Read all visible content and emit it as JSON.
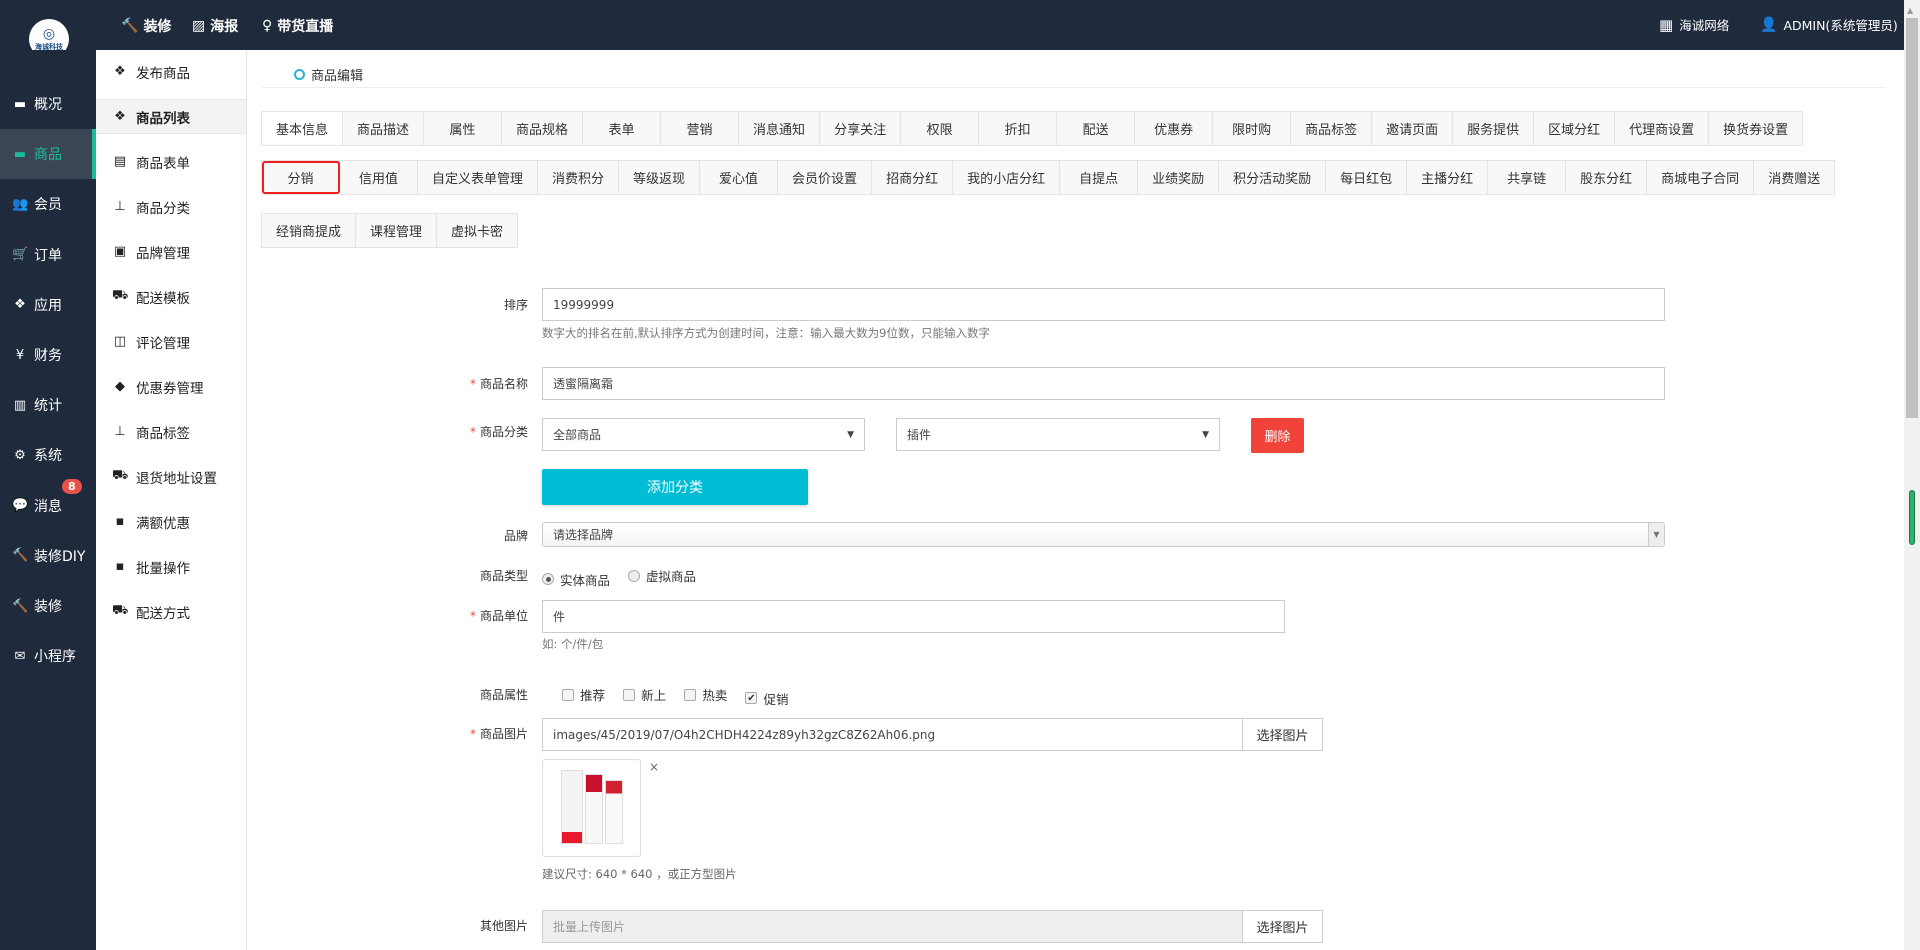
{
  "topbar": {
    "logo_text": "海诚科技",
    "nav": [
      {
        "icon": "hammer-icon",
        "label": "装修"
      },
      {
        "icon": "image-icon",
        "label": "海报"
      },
      {
        "icon": "mic-icon",
        "label": "带货直播"
      }
    ],
    "company": "海诚网络",
    "user": "ADMIN(系统管理员)"
  },
  "sidebar": {
    "items": [
      {
        "label": "概况",
        "icon": "archive-icon"
      },
      {
        "label": "商品",
        "icon": "archive-icon"
      },
      {
        "label": "会员",
        "icon": "users-icon"
      },
      {
        "label": "订单",
        "icon": "cart-icon"
      },
      {
        "label": "应用",
        "icon": "cubes-icon"
      },
      {
        "label": "财务",
        "icon": "yen-icon"
      },
      {
        "label": "统计",
        "icon": "bar-chart-icon"
      },
      {
        "label": "系统",
        "icon": "gears-icon"
      },
      {
        "label": "消息",
        "icon": "chat-icon",
        "badge": "8"
      },
      {
        "label": "装修DIY",
        "icon": "hammer-icon"
      },
      {
        "label": "装修",
        "icon": "hammer-icon"
      },
      {
        "label": "小程序",
        "icon": "wechat-icon"
      }
    ],
    "active": "商品"
  },
  "submenu": {
    "items": [
      {
        "label": "发布商品",
        "icon": "cubes-icon"
      },
      {
        "label": "商品列表",
        "icon": "cubes-icon"
      },
      {
        "label": "商品表单",
        "icon": "excel-icon"
      },
      {
        "label": "商品分类",
        "icon": "sitemap-icon"
      },
      {
        "label": "品牌管理",
        "icon": "briefcase-icon"
      },
      {
        "label": "配送模板",
        "icon": "truck-icon"
      },
      {
        "label": "评论管理",
        "icon": "columns-icon"
      },
      {
        "label": "优惠券管理",
        "icon": "tags-icon"
      },
      {
        "label": "商品标签",
        "icon": "sitemap-icon"
      },
      {
        "label": "退货地址设置",
        "icon": "truck-icon"
      },
      {
        "label": "满额优惠",
        "icon": "gift-icon"
      },
      {
        "label": "批量操作",
        "icon": "gift-icon"
      },
      {
        "label": "配送方式",
        "icon": "truck-icon"
      }
    ],
    "active": "商品列表"
  },
  "breadcrumb": "商品编辑",
  "tabs": {
    "row1": [
      "基本信息",
      "商品描述",
      "属性",
      "商品规格",
      "表单",
      "营销",
      "消息通知",
      "分享关注",
      "权限",
      "折扣",
      "配送",
      "优惠券",
      "限时购",
      "商品标签",
      "邀请页面",
      "服务提供",
      "区域分红",
      "代理商设置",
      "换货券设置"
    ],
    "row2": [
      "分销",
      "信用值",
      "自定义表单管理",
      "消费积分",
      "等级返现",
      "爱心值",
      "会员价设置",
      "招商分红",
      "我的小店分红",
      "自提点",
      "业绩奖励",
      "积分活动奖励",
      "每日红包",
      "主播分红",
      "共享链",
      "股东分红",
      "商城电子合同",
      "消费赠送"
    ],
    "row3": [
      "经销商提成",
      "课程管理",
      "虚拟卡密"
    ],
    "highlighted": "分销"
  },
  "form": {
    "sort": {
      "label": "排序",
      "value": "19999999",
      "hint": "数字大的排名在前,默认排序方式为创建时间，注意：输入最大数为9位数，只能输入数字"
    },
    "name": {
      "label": "商品名称",
      "value": "透蜜隔离霜"
    },
    "category": {
      "label": "商品分类",
      "select1": "全部商品",
      "select2": "插件",
      "delete": "删除",
      "add": "添加分类"
    },
    "brand": {
      "label": "品牌",
      "value": "请选择品牌"
    },
    "type": {
      "label": "商品类型",
      "options": [
        "实体商品",
        "虚拟商品"
      ],
      "selected": "实体商品"
    },
    "unit": {
      "label": "商品单位",
      "value": "件",
      "hint": "如: 个/件/包"
    },
    "attrs": {
      "label": "商品属性",
      "options": [
        {
          "label": "推荐",
          "checked": false
        },
        {
          "label": "新上",
          "checked": false
        },
        {
          "label": "热卖",
          "checked": false
        },
        {
          "label": "促销",
          "checked": true
        }
      ]
    },
    "image": {
      "label": "商品图片",
      "value": "images/45/2019/07/O4h2CHDH4224z89yh32gzC8Z62Ah06.png",
      "button": "选择图片",
      "remove": "×",
      "hint": "建议尺寸: 640 * 640 ，或正方型图片"
    },
    "other": {
      "label": "其他图片",
      "placeholder": "批量上传图片",
      "button": "选择图片"
    },
    "required_mark": "*"
  },
  "colors": {
    "topbar": "#1f2b3c",
    "active": "#1abc9c",
    "add": "#00bcd4",
    "delete": "#f0443a",
    "highlight": "#f01e1e"
  }
}
